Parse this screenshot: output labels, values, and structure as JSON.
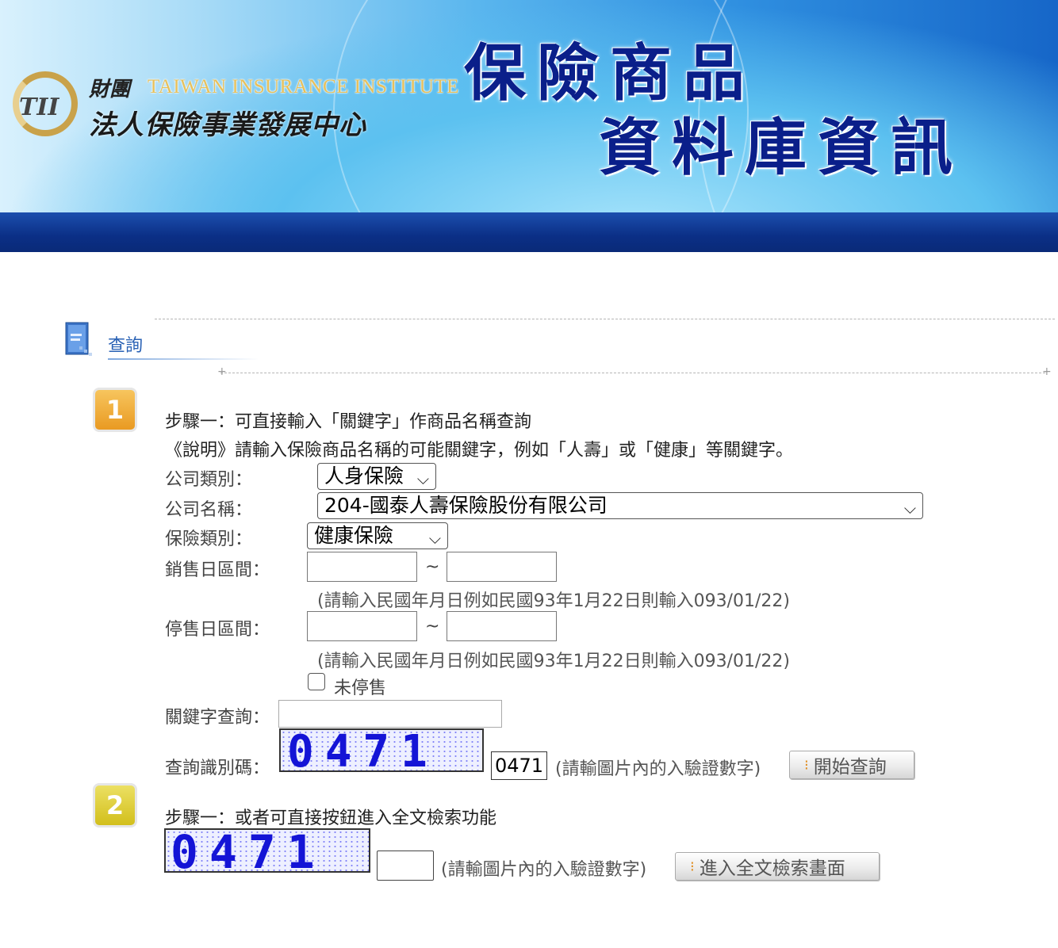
{
  "banner": {
    "logo_mark": "TII",
    "org_cn_line1": "財團",
    "org_en": "TAIWAN INSURANCE INSTITUTE",
    "org_cn_line2": "法人保險事業發展中心",
    "title_line1": "保險商品",
    "title_line2": "資料庫資訊",
    "colors": {
      "banner_start": "#d9f1fd",
      "banner_end": "#1666c8",
      "bar": "#0b2f86",
      "title": "#0a1f8a"
    }
  },
  "section": {
    "title": "查詢",
    "icon": "document-icon"
  },
  "step1": {
    "badge": "1",
    "heading": "步驟一：可直接輸入「關鍵字」作商品名稱查詢",
    "description": "《說明》請輸入保險商品名稱的可能關鍵字，例如「人壽」或「健康」等關鍵字。",
    "company_type_label": "公司類別：",
    "company_type_value": "人身保險",
    "company_name_label": "公司名稱：",
    "company_name_value": "204-國泰人壽保險股份有限公司",
    "insurance_type_label": "保險類別：",
    "insurance_type_value": "健康保險",
    "sale_date_label": "銷售日區間：",
    "sale_date_from": "",
    "sale_date_to": "",
    "range_separator": "~",
    "date_hint": "(請輸入民國年月日例如民國93年1月22日則輸入093/01/22)",
    "stop_date_label": "停售日區間：",
    "stop_date_from": "",
    "stop_date_to": "",
    "not_stopped_label": "未停售",
    "keyword_label": "關鍵字查詢：",
    "keyword_value": "",
    "captcha_label": "查詢識別碼：",
    "captcha_image_text": "0471",
    "captcha_input": "0471",
    "captcha_hint": "(請輸圖片內的入驗證數字)",
    "search_button": "開始查詢"
  },
  "step2": {
    "badge": "2",
    "heading": "步驟一：或者可直接按鈕進入全文檢索功能",
    "captcha_image_text": "0471",
    "captcha_input": "",
    "captcha_hint": "(請輸圖片內的入驗證數字)",
    "fulltext_button": "進入全文檢索畫面"
  }
}
